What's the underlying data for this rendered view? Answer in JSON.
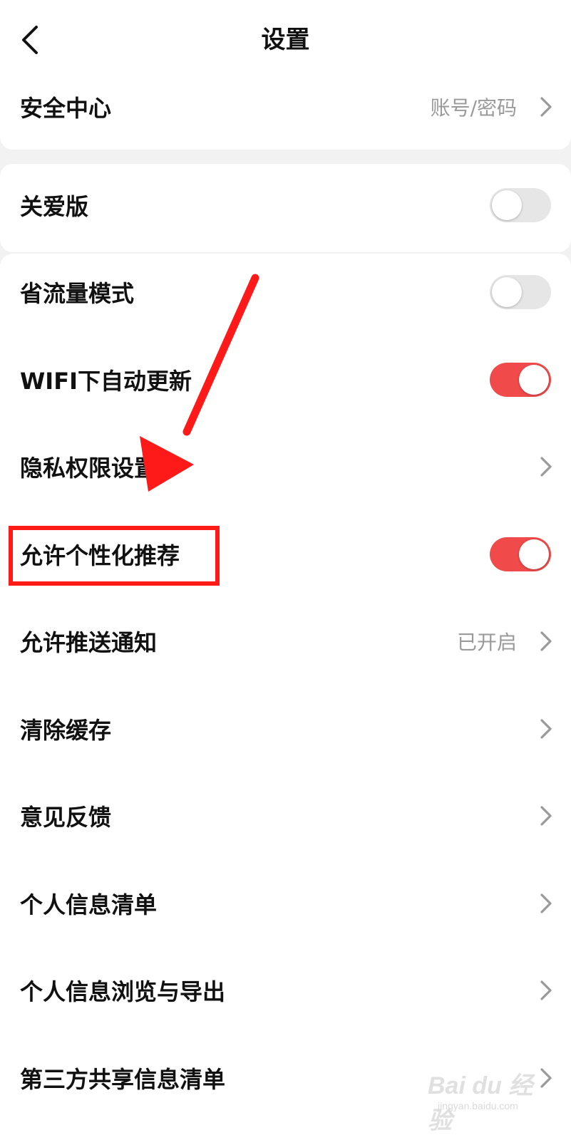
{
  "header": {
    "title": "设置",
    "back_icon": "chevron-left-icon"
  },
  "security": {
    "label": "安全中心",
    "value": "账号/密码"
  },
  "care": {
    "label": "关爱版",
    "on": false
  },
  "rows": [
    {
      "label": "省流量模式",
      "type": "toggle",
      "on": false
    },
    {
      "label": "WIFI下自动更新",
      "type": "toggle",
      "on": true
    },
    {
      "label": "隐私权限设置",
      "type": "link"
    },
    {
      "label": "允许个性化推荐",
      "type": "toggle",
      "on": true
    },
    {
      "label": "允许推送通知",
      "type": "link",
      "value": "已开启"
    },
    {
      "label": "清除缓存",
      "type": "link"
    },
    {
      "label": "意见反馈",
      "type": "link"
    },
    {
      "label": "个人信息清单",
      "type": "link"
    },
    {
      "label": "个人信息浏览与导出",
      "type": "link"
    },
    {
      "label": "第三方共享信息清单",
      "type": "link"
    }
  ],
  "colors": {
    "toggle_on": "#f04a4a",
    "toggle_off": "#e6e6e6",
    "annotation": "#ff1a1a"
  },
  "watermark": {
    "text": "Bai du 经验",
    "sub": "jingyan.baidu.com"
  }
}
